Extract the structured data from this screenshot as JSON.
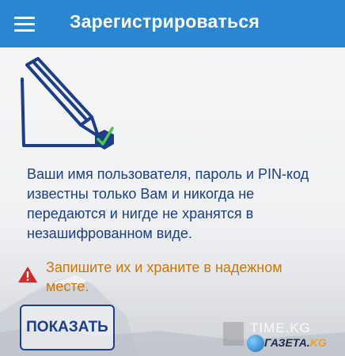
{
  "app_bar": {
    "title": "Зарегистрироваться",
    "menu_icon": "hamburger-menu-icon",
    "color": "#2b86d1"
  },
  "illustration": {
    "icon": "pencil-signature-shield-icon",
    "badge_icon": "check-shield-icon"
  },
  "info_text": "Ваши имя пользователя, пароль и PIN-код известны только Вам и никогда не передаются и нигде не хранятся в незашифрованном виде.",
  "warning": {
    "icon": "warning-triangle-icon",
    "text": "Запишите их и храните в надежном месте.",
    "color": "#c8780a"
  },
  "show_button": {
    "label": "ПОКАЗАТЬ"
  },
  "watermark": {
    "time_text": "TIME.KG",
    "gazeta_text": "ГАЗЕТА.",
    "gazeta_suffix": "KG"
  }
}
